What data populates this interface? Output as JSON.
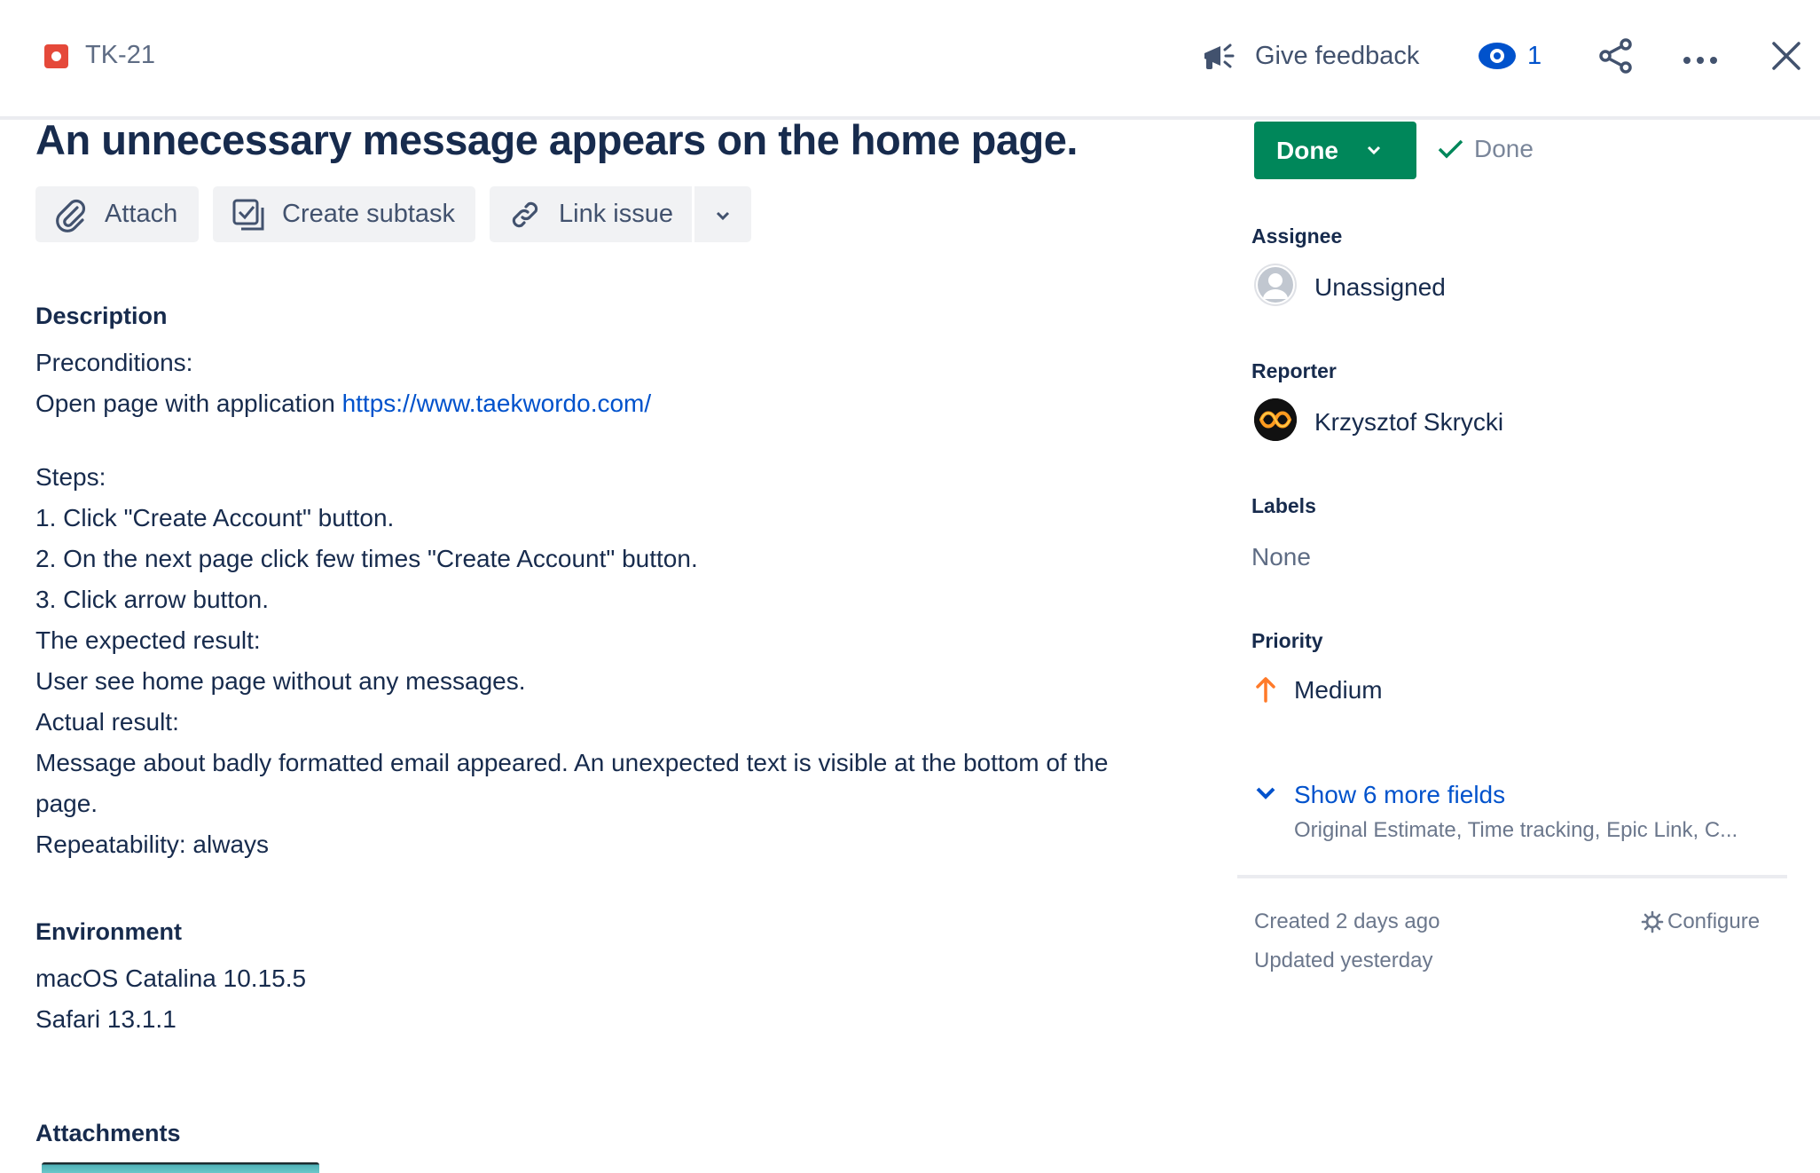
{
  "header": {
    "issue_key": "TK-21",
    "feedback_label": "Give feedback",
    "watch_count": "1"
  },
  "issue": {
    "title": "An unnecessary message appears on the home page.",
    "actions": {
      "attach": "Attach",
      "create_subtask": "Create subtask",
      "link_issue": "Link issue"
    }
  },
  "description": {
    "heading": "Description",
    "lines": [
      "Preconditions:",
      "Open page with application ",
      "Steps:",
      "1. Click \"Create Account\" button.",
      "2. On the next page click few times \"Create Account\" button.",
      "3. Click arrow button.",
      "The expected result:",
      "User see home page without any messages.",
      "Actual result:",
      "Message about badly formatted email appeared. An unexpected text is visible at the bottom of the",
      "page.",
      "Repeatability: always"
    ],
    "link": "https://www.taekwordo.com/"
  },
  "environment": {
    "heading": "Environment",
    "lines": [
      "macOS Catalina 10.15.5",
      "Safari 13.1.1"
    ]
  },
  "attachments": {
    "heading": "Attachments"
  },
  "sidebar": {
    "status_label": "Done",
    "resolution_label": "Done",
    "assignee": {
      "label": "Assignee",
      "value": "Unassigned"
    },
    "reporter": {
      "label": "Reporter",
      "value": "Krzysztof Skrycki"
    },
    "labels": {
      "label": "Labels",
      "value": "None"
    },
    "priority": {
      "label": "Priority",
      "value": "Medium"
    },
    "show_more": {
      "label": "Show 6 more fields",
      "sub": "Original Estimate, Time tracking, Epic Link, C..."
    },
    "created": "Created 2 days ago",
    "updated": "Updated yesterday",
    "configure": "Configure"
  },
  "colors": {
    "status_done": "#00875a",
    "link": "#0052cc",
    "bug_type": "#e5493a",
    "priority_medium": "#ff7a29"
  }
}
